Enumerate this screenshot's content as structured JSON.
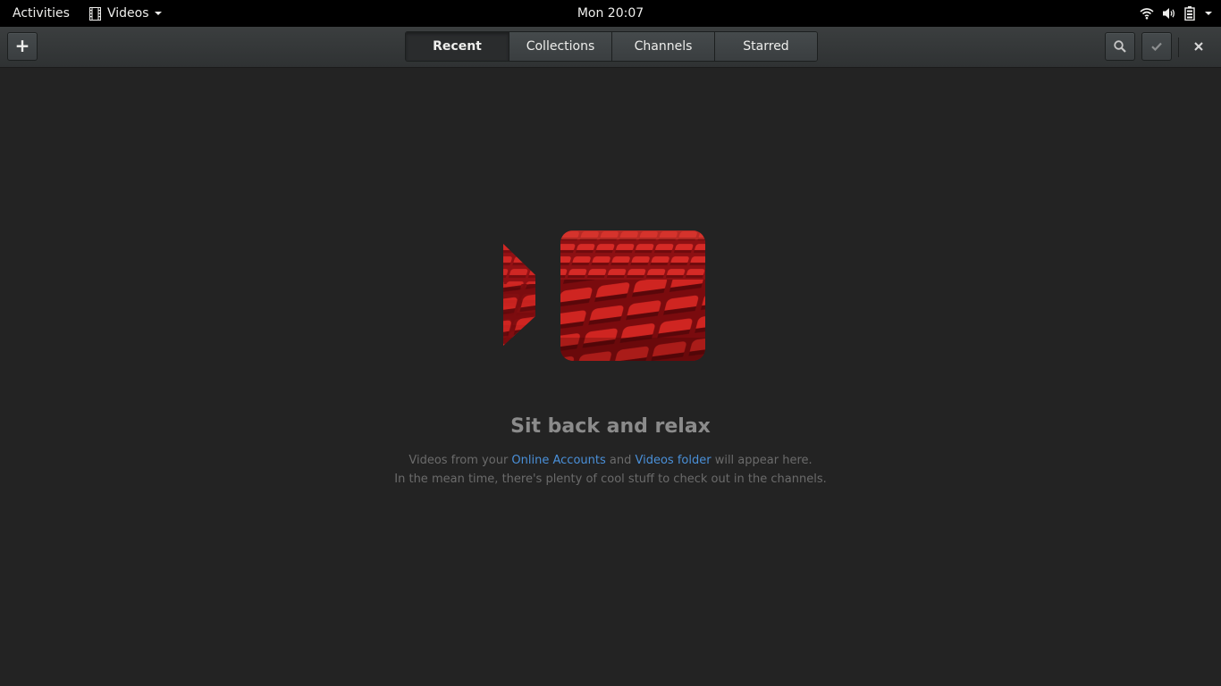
{
  "topbar": {
    "activities": "Activities",
    "app_name": "Videos",
    "clock": "Mon 20:07",
    "status_icons": [
      "wifi-icon",
      "volume-icon",
      "battery-icon",
      "chevron-down-icon"
    ]
  },
  "headerbar": {
    "add_label": "+",
    "tabs": [
      {
        "label": "Recent",
        "active": true
      },
      {
        "label": "Collections",
        "active": false
      },
      {
        "label": "Channels",
        "active": false
      },
      {
        "label": "Starred",
        "active": false
      }
    ],
    "icons": [
      "search-icon",
      "checkmark-icon",
      "close-icon"
    ]
  },
  "empty_state": {
    "title": "Sit back and relax",
    "line1_before": "Videos from your ",
    "line1_link1": "Online Accounts",
    "line1_middle": " and ",
    "line1_link2": "Videos folder",
    "line1_after": " will appear here.",
    "line2": "In the mean time, there's plenty of cool stuff to check out in the channels."
  },
  "colors": {
    "background": "#232323",
    "link": "#4a90d9",
    "seat_red": "#c0201a"
  }
}
